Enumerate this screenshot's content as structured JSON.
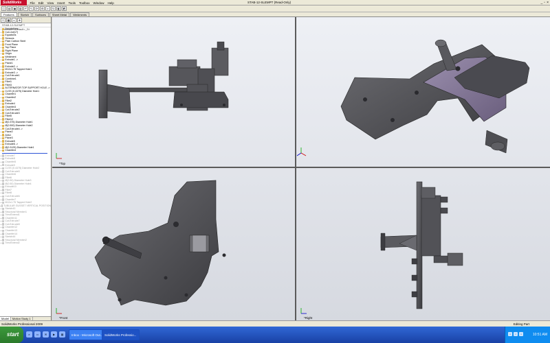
{
  "app": {
    "logo": "SolidWorks",
    "doc_title": "STAB-12-SLEMPT (Read-Only)",
    "menus": [
      "File",
      "Edit",
      "View",
      "Insert",
      "Tools",
      "Toolbox",
      "Window",
      "Help"
    ],
    "window_controls": [
      "_",
      "▫",
      "×"
    ]
  },
  "toolbar": {
    "buttons": [
      "new-icon",
      "open-icon",
      "save-icon",
      "print-icon",
      "undo-icon",
      "select-icon",
      "rebuild-icon",
      "options-icon",
      "zoom-icon",
      "rotate-icon",
      "view-icon",
      "display-icon"
    ]
  },
  "command_tabs": [
    "Features",
    "Sketch",
    "Surfaces",
    "Sheet Metal",
    "Weldments"
  ],
  "feature_manager": {
    "filter": "STAB-12-SLEMPT (Default<<Default>_Di",
    "tree": [
      {
        "label": "Annotations",
        "state": "normal"
      },
      {
        "label": "Cut-List(17)",
        "state": "normal"
      },
      {
        "label": "Equations",
        "state": "normal"
      },
      {
        "label": "Sensors",
        "state": "normal"
      },
      {
        "label": "Plain Carbon Steel",
        "state": "normal"
      },
      {
        "label": "Front Plane",
        "state": "normal"
      },
      {
        "label": "Top Plane",
        "state": "normal"
      },
      {
        "label": "Right Plane",
        "state": "normal"
      },
      {
        "label": "Origin",
        "state": "normal"
      },
      {
        "label": "Weldment",
        "state": "normal"
      },
      {
        "label": "Extrude1 ->",
        "state": "normal"
      },
      {
        "label": "Plane1",
        "state": "normal"
      },
      {
        "label": "Extrude2 ->",
        "state": "normal"
      },
      {
        "label": "M12x1.75 Tapped Hole1",
        "state": "normal"
      },
      {
        "label": "Extrude3 ->",
        "state": "normal"
      },
      {
        "label": "Cut-Extrude1",
        "state": "normal"
      },
      {
        "label": "Combine1",
        "state": "normal"
      },
      {
        "label": "Fillet1",
        "state": "normal"
      },
      {
        "label": "Fillet3",
        "state": "normal"
      },
      {
        "label": "ALTERNATOR TOP SUPPORT HOLE -> ",
        "state": "normal"
      },
      {
        "label": "CLSS (0.4375) Diameter Hole1",
        "state": "normal"
      },
      {
        "label": "Chamfer1",
        "state": "normal"
      },
      {
        "label": "Chamfer2",
        "state": "normal"
      },
      {
        "label": "Fillet2",
        "state": "normal"
      },
      {
        "label": "Extrude4",
        "state": "normal"
      },
      {
        "label": "Chamfer3",
        "state": "normal"
      },
      {
        "label": "Cut-Extrude2",
        "state": "normal"
      },
      {
        "label": "Cut-Extrude3",
        "state": "normal"
      },
      {
        "label": "Fillet5",
        "state": "normal"
      },
      {
        "label": "Fillet12",
        "state": "normal"
      },
      {
        "label": "Ø(0.375) Diameter Hole1",
        "state": "normal"
      },
      {
        "label": "Ø(0.500) Diameter Hole2",
        "state": "normal"
      },
      {
        "label": "Cut-Extrude4 ->",
        "state": "normal"
      },
      {
        "label": "Plane2",
        "state": "normal"
      },
      {
        "label": "Axis1",
        "state": "normal"
      },
      {
        "label": "Plane3",
        "state": "normal"
      },
      {
        "label": "Extrude5",
        "state": "normal"
      },
      {
        "label": "Extrude6 ->",
        "state": "normal"
      },
      {
        "label": "Ø(0.3125) Diameter Hole1",
        "state": "normal"
      },
      {
        "label": "Chamfer4",
        "state": "normal"
      },
      {
        "label": "",
        "state": "rollback"
      },
      {
        "label": "Extrude7",
        "state": "dim"
      },
      {
        "label": "Extrude8",
        "state": "dim"
      },
      {
        "label": "Chamfer5",
        "state": "dim"
      },
      {
        "label": "Extrude9",
        "state": "dim"
      },
      {
        "label": "CLSS (0.4375) Diameter Hole2",
        "state": "dim"
      },
      {
        "label": "Cut-Extrude5",
        "state": "dim"
      },
      {
        "label": "Chamfer6",
        "state": "dim"
      },
      {
        "label": "Fillet6",
        "state": "dim"
      },
      {
        "label": "Ø(0.50) Diameter Hole3",
        "state": "dim"
      },
      {
        "label": "Ø(0.50) Diameter Hole4",
        "state": "dim"
      },
      {
        "label": "Extrude10",
        "state": "dim"
      },
      {
        "label": "Fillet7",
        "state": "dim"
      },
      {
        "label": "Fillet8",
        "state": "dim"
      },
      {
        "label": "Cut-Extrude6",
        "state": "dim"
      },
      {
        "label": "Chamfer7",
        "state": "dim"
      },
      {
        "label": "M12x1.75 Tapped Hole2",
        "state": "dim"
      },
      {
        "label": "TUBULAR GUSSET VERTICAL POSITION",
        "state": "dim"
      },
      {
        "label": "Sketch43",
        "state": "dim"
      },
      {
        "label": "Structural Member1",
        "state": "dim"
      },
      {
        "label": "Trim/Extend1",
        "state": "dim"
      },
      {
        "label": "Chamfer11",
        "state": "dim"
      },
      {
        "label": "Cut-Extrude7",
        "state": "dim"
      },
      {
        "label": "Cut-Extrude8",
        "state": "dim"
      },
      {
        "label": "Chamfer12",
        "state": "dim"
      },
      {
        "label": "Chamfer13",
        "state": "dim"
      },
      {
        "label": "Chamfer14",
        "state": "dim"
      },
      {
        "label": "Sketch44",
        "state": "dim"
      },
      {
        "label": "Structural Member2",
        "state": "dim"
      },
      {
        "label": "Trim/Extend2",
        "state": "dim"
      }
    ],
    "bottom_tabs": [
      "Model",
      "Motion Study 1"
    ]
  },
  "viewports": {
    "top_label": "*Top",
    "front_label": "*Front",
    "right_label": "*Right"
  },
  "status": {
    "left": "SolidWorks Professional 2009",
    "right": "Editing Part"
  },
  "taskbar": {
    "start": "start",
    "quick_launch": [
      "ie-icon",
      "folder-icon",
      "mail-icon",
      "media-icon",
      "desktop-icon"
    ],
    "tasks": [
      {
        "label": "Inbox - Microsoft Out...",
        "active": false
      },
      {
        "label": "SolidWorks Professio...",
        "active": true
      }
    ],
    "clock": "10:51 AM"
  },
  "colors": {
    "part_fill": "#5a5a5e",
    "part_dark": "#3a3a3e",
    "part_highlight": "#8a7d9a",
    "viewport_divider": "#5a5a5a",
    "logo_red": "#c8102e"
  }
}
